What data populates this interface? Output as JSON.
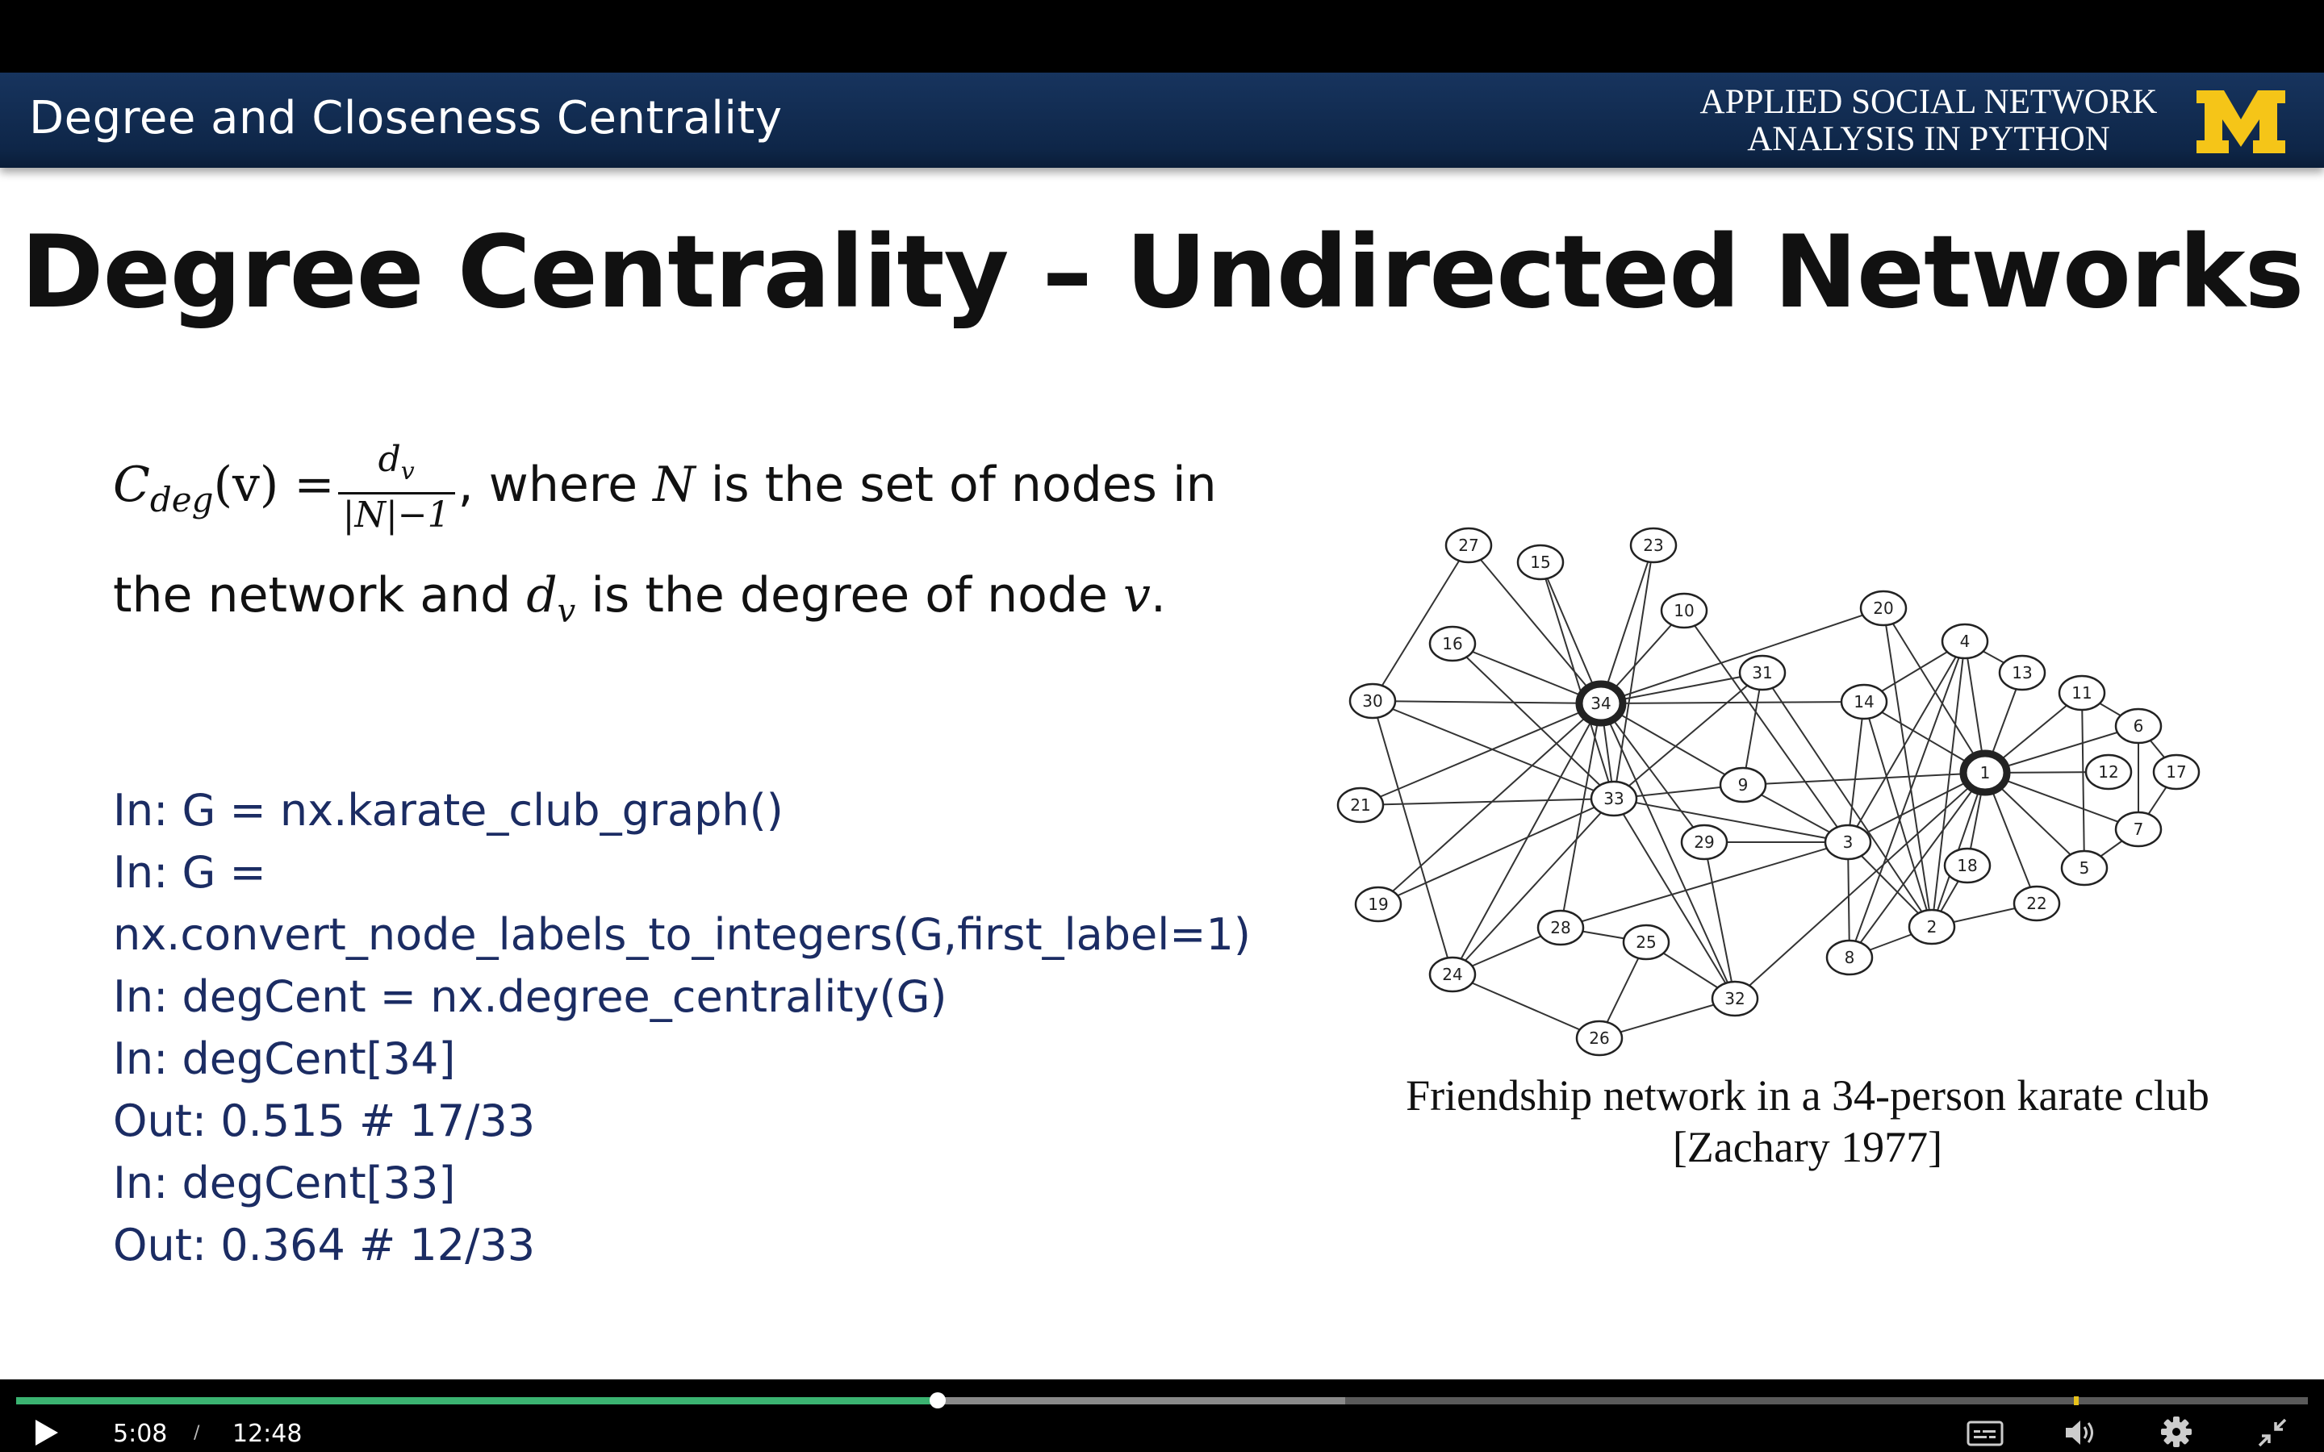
{
  "banner": {
    "title": "Degree and Closeness Centrality",
    "course_line1": "APPLIED SOCIAL NETWORK",
    "course_line2": "ANALYSIS IN PYTHON",
    "logo": "M",
    "logo_color": "#f5c518"
  },
  "slide": {
    "title": "Degree Centrality – Undirected Networks",
    "formula": {
      "lhs_base": "C",
      "lhs_sub": "deg",
      "lhs_arg": "(v) =",
      "num_base": "d",
      "num_sub": "v",
      "den": "|N|−1",
      "after": ", where",
      "var_N": "N",
      "text1": "is the set of nodes in",
      "text2": "the network and",
      "dv_base": "d",
      "dv_sub": "v",
      "text3": "is the degree of node",
      "var_v": "v",
      "period": "."
    },
    "code_lines": [
      "In: G = nx.karate_club_graph()",
      "In: G =",
      "nx.convert_node_labels_to_integers(G,first_label=1)",
      "In: degCent = nx.degree_centrality(G)",
      "In: degCent[34]",
      "Out: 0.515 # 17/33",
      "In: degCent[33]",
      "Out: 0.364 # 12/33"
    ],
    "caption_line1": "Friendship network in a 34-person karate club",
    "caption_line2": "[Zachary 1977]"
  },
  "graph": {
    "nodes": [
      "1",
      "2",
      "3",
      "4",
      "5",
      "6",
      "7",
      "8",
      "9",
      "10",
      "11",
      "12",
      "13",
      "14",
      "17",
      "18",
      "19",
      "20",
      "21",
      "22",
      "23",
      "24",
      "25",
      "26",
      "27",
      "28",
      "29",
      "30",
      "31",
      "32",
      "33",
      "34",
      "15",
      "16"
    ],
    "hubs": [
      "1",
      "34"
    ]
  },
  "player": {
    "current_time": "5:08",
    "separator": "/",
    "duration": "12:48",
    "played_fraction": 0.402,
    "buffered_fraction": 0.58,
    "marker_fraction": 0.898,
    "accent_color": "#3bb371"
  }
}
